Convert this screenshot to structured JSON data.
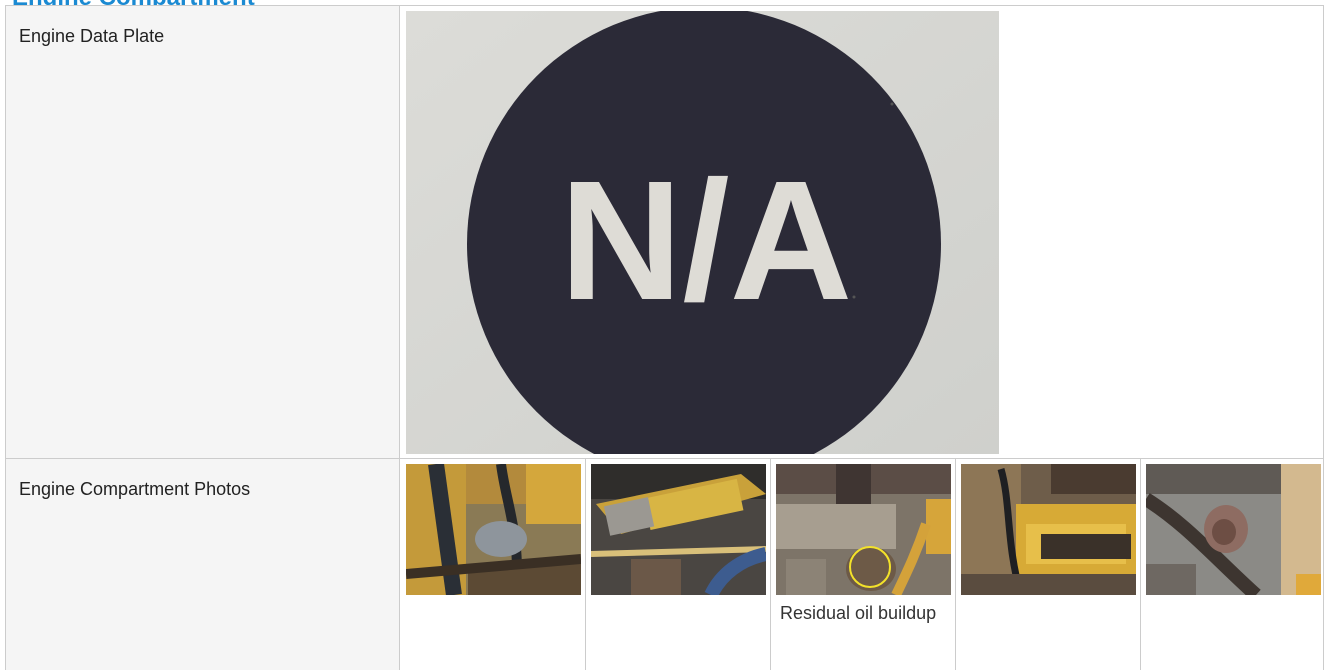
{
  "section": {
    "title": "Engine Compartment"
  },
  "rows": [
    {
      "label": "Engine Data Plate",
      "placeholder_text": "N/A"
    },
    {
      "label": "Engine Compartment Photos",
      "photos": [
        {
          "caption": ""
        },
        {
          "caption": ""
        },
        {
          "caption": "Residual oil buildup"
        },
        {
          "caption": ""
        },
        {
          "caption": ""
        }
      ]
    }
  ],
  "colors": {
    "title_accent": "#1b8ad2",
    "label_background": "#f5f5f5",
    "border": "#cccccc",
    "na_circle": "#2b2a37",
    "annotation_circle": "#f3e22a"
  }
}
